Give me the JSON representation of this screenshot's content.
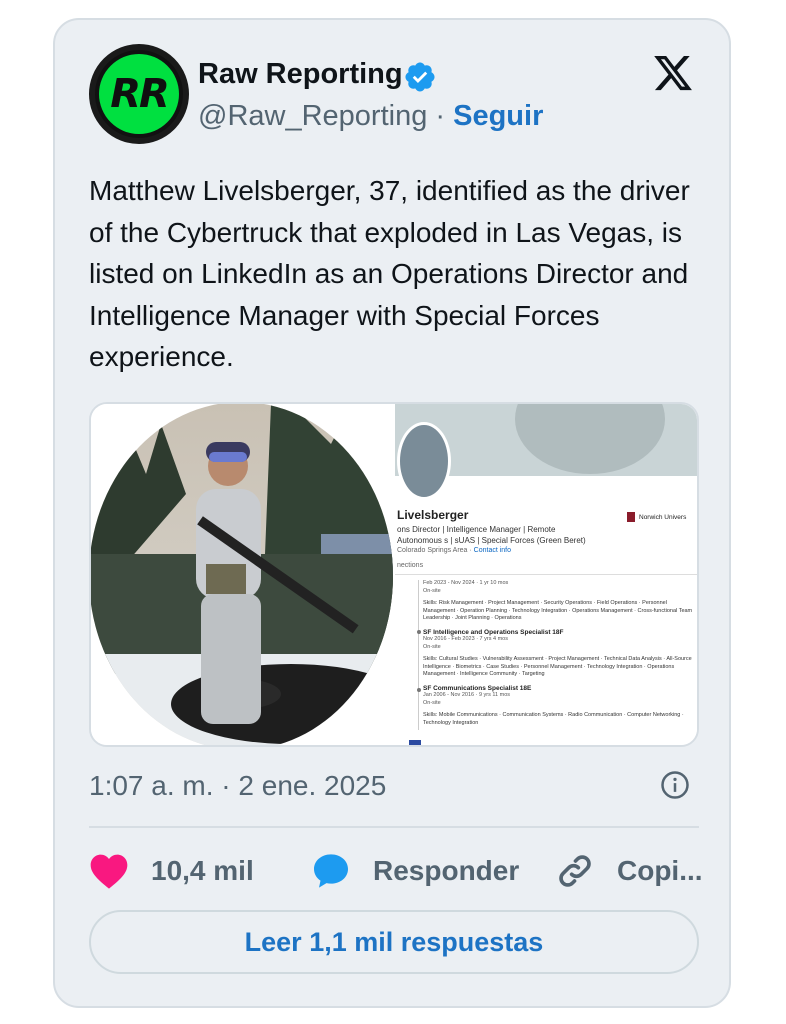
{
  "author": {
    "avatar_text": "RR",
    "name": "Raw Reporting",
    "verified_icon": "verified-badge-icon",
    "handle": "@Raw_Reporting",
    "separator": "·",
    "follow_label": "Seguir"
  },
  "platform_icon": "x-logo-icon",
  "tweet": {
    "text": "Matthew Livelsberger, 37, identified as the driver of the Cybertruck that exploded in Las Vegas, is listed on LinkedIn as an Operations Director and Intelligence Manager with Special Forces experience."
  },
  "media": {
    "linkedin": {
      "name": "Livelsberger",
      "title": "ons Director | Intelligence Manager | Remote Autonomous s | sUAS | Special Forces (Green Beret)",
      "location": "Colorado Springs Area · ",
      "contact": "Contact info",
      "connections": "nections",
      "university": "Norwich Univers",
      "entries": [
        {
          "title": "",
          "dates": "Feb 2023 - Nov 2024 · 1 yr 10 mos",
          "site": "On-site",
          "skills": "Skills: Risk Management · Project Management · Security Operations · Field Operations · Personnel Management · Operation Planning · Technology Integration · Operations Management · Cross-functional Team Leadership · Joint Planning · Operations"
        },
        {
          "title": "SF Intelligence and Operations Specialist 18F",
          "dates": "Nov 2016 - Feb 2023 · 7 yrs 4 mos",
          "site": "On-site",
          "skills": "Skills: Cultural Studies · Vulnerability Assessment · Project Management · Technical Data Analysis · All-Source Intelligence · Biometrics · Case Studies · Personnel Management · Technology Integration · Operations Management · Intelligence Community · Targeting"
        },
        {
          "title": "SF Communications Specialist 18E",
          "dates": "Jan 2006 - Nov 2016 · 9 yrs 11 mos",
          "site": "On-site",
          "skills": "Skills: Mobile Communications · Communication Systems · Radio Communication · Computer Networking · Technology Integration"
        }
      ]
    }
  },
  "timestamp": "1:07 a. m. · 2 ene. 2025",
  "info_icon": "info-icon",
  "actions": {
    "likes_count": "10,4 mil",
    "reply_label": "Responder",
    "copy_label": "Copi..."
  },
  "read_replies_label": "Leer 1,1 mil respuestas",
  "colors": {
    "accent": "#1d73c4",
    "heart": "#f91880",
    "card_bg": "#ebeff3",
    "secondary_text": "#536471"
  }
}
